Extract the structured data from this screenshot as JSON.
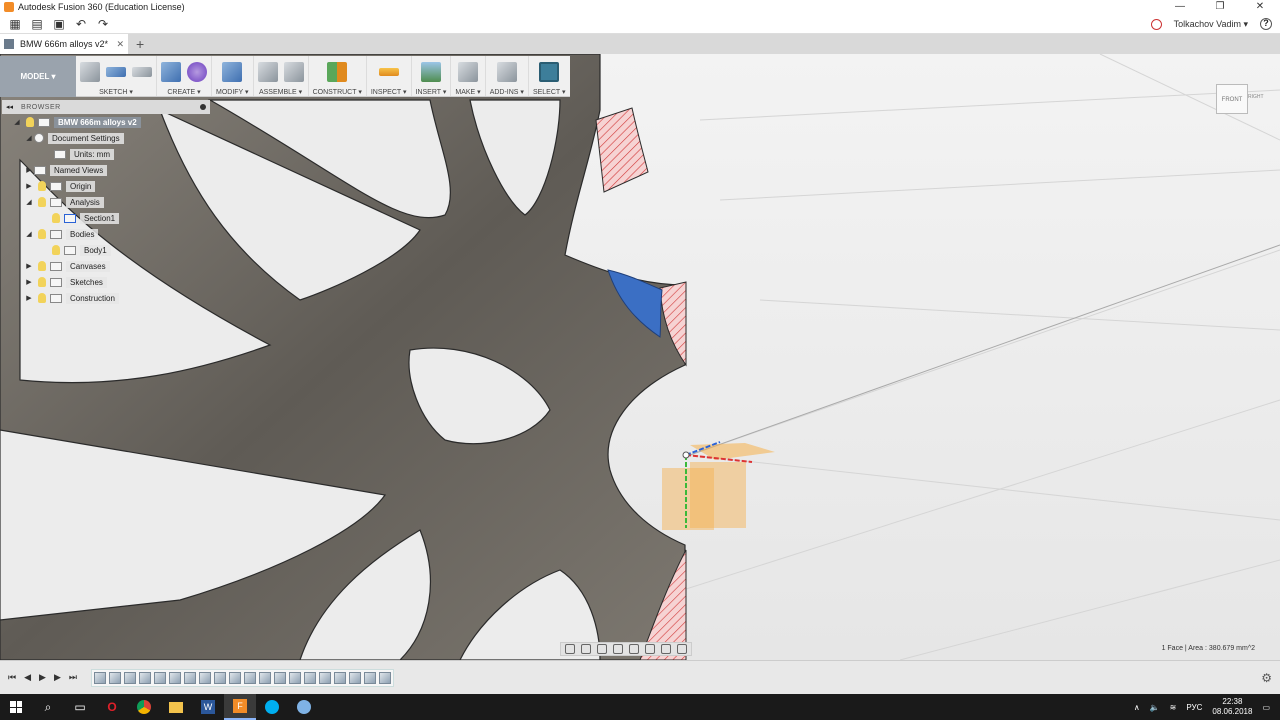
{
  "window": {
    "title": "Autodesk Fusion 360 (Education License)",
    "minimize": "—",
    "maximize": "❐",
    "close": "✕"
  },
  "header": {
    "user": "Tolkachov Vadim ▾",
    "help": "?"
  },
  "tabs": [
    {
      "label": "BMW 666m alloys v2*"
    }
  ],
  "toolbar": {
    "workspace": "MODEL ▾",
    "groups": [
      {
        "label": "SKETCH ▾"
      },
      {
        "label": "CREATE ▾"
      },
      {
        "label": "MODIFY ▾"
      },
      {
        "label": "ASSEMBLE ▾"
      },
      {
        "label": "CONSTRUCT ▾"
      },
      {
        "label": "INSPECT ▾"
      },
      {
        "label": "INSERT ▾"
      },
      {
        "label": "MAKE ▾"
      },
      {
        "label": "ADD-INS ▾"
      },
      {
        "label": "SELECT ▾"
      }
    ]
  },
  "browser": {
    "title": "BROWSER",
    "items": [
      {
        "label": "BMW 666m alloys v2",
        "arrow": "◢"
      },
      {
        "label": "Document Settings",
        "arrow": "◢"
      },
      {
        "label": "Units: mm",
        "arrow": ""
      },
      {
        "label": "Named Views",
        "arrow": "▶"
      },
      {
        "label": "Origin",
        "arrow": "▶"
      },
      {
        "label": "Analysis",
        "arrow": "◢"
      },
      {
        "label": "Section1",
        "arrow": ""
      },
      {
        "label": "Bodies",
        "arrow": "◢"
      },
      {
        "label": "Body1",
        "arrow": ""
      },
      {
        "label": "Canvases",
        "arrow": "▶"
      },
      {
        "label": "Sketches",
        "arrow": "▶"
      },
      {
        "label": "Construction",
        "arrow": "▶"
      }
    ]
  },
  "viewcube": {
    "front_label": "FRONT",
    "right_label": "RIGHT"
  },
  "status": {
    "selection": "1 Face | Area : 380.679 mm^2"
  },
  "colors": {
    "accent": "#0696d7",
    "wheel": "#6f6a63",
    "section_fill": "#f4c6c6",
    "section_hatch": "#d23a3a",
    "selected_face": "#3b6fc4",
    "plane": "#f6b04b"
  },
  "taskbar": {
    "language": "РУС",
    "time": "22:38",
    "date": "08.06.2018"
  }
}
